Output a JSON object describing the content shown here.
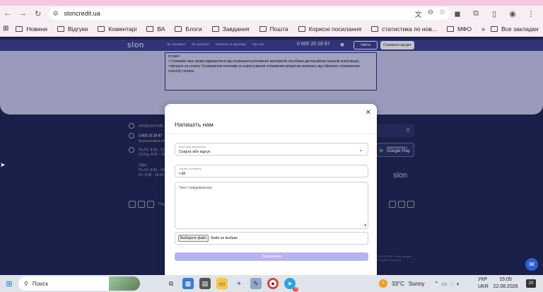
{
  "browser": {
    "url": "sloncredit.ua",
    "bookmarks": [
      "Новини",
      "Відгуки",
      "Коментарі",
      "ВА",
      "Блоги",
      "Завдання",
      "Пошта",
      "Корисні посилання",
      "статистика по нов...",
      "МФО"
    ],
    "all_bookmarks": "Все закладки",
    "icons": [
      "back-arrow-icon",
      "forward-arrow-icon",
      "reload-icon",
      "translate-icon",
      "zoom-icon",
      "star-icon",
      "extension-icon",
      "profile-icon",
      "menu-icon"
    ]
  },
  "site": {
    "logo": "slon",
    "nav": [
      "Як отримати",
      "Як погасити",
      "Питання та відповіді",
      "Про нас"
    ],
    "phone": "0 800 20 28 87",
    "login": "Увійти",
    "cta": "Отримати кредит",
    "info_text": "історія;\n• Споживач має право відмовитися від отримання рекламних матеріалів засобами дистанційних каналів комунікації;\n• витрати на сплату Споживачем платежів за користування споживчим кредитом залежать від обраного споживачем способу оплати.",
    "footer": {
      "email": "info@sloncredit...",
      "footer_phone": "0 800 20 28 87",
      "footer_phone_note": "Безкоштовно по Укр...",
      "hours1a": "Пн-Пт: 8:00 - 20:...",
      "hours1b": "Сб-Нд: 8:00 - 20:...",
      "office_title": "Офіс:",
      "office_hours1": "Пн-Чт: 9:00 - 18:...",
      "office_hours2": "Пт: 9:00 - 16:00",
      "gplay_top": "ЗАВАНТАЖИТИ З",
      "gplay": "Google Play",
      "logo_footer": "slon",
      "social_label": "Під...",
      "copyright": "© 2026 ТОВ «Слон кредит»\nВсі права захищені"
    }
  },
  "modal": {
    "title": "Напишіть нам",
    "category_label": "Категорія звернення",
    "category_value": "Скарга або відгук",
    "phone_label": "Номер телефону",
    "phone_value": "+38",
    "message_placeholder": "Текст повідомлення",
    "file_button": "Выберите файл",
    "file_status": "Файл не выбран",
    "submit": "Повідомити"
  },
  "taskbar": {
    "search": "Поиск",
    "weather_temp": "33°C",
    "weather_text": "Sunny",
    "weather_badge": "1",
    "lang1": "УКР",
    "lang2": "UKR",
    "time": "15:05",
    "date": "22.08.2026",
    "notifications": "20",
    "telegram_badge": "19"
  }
}
